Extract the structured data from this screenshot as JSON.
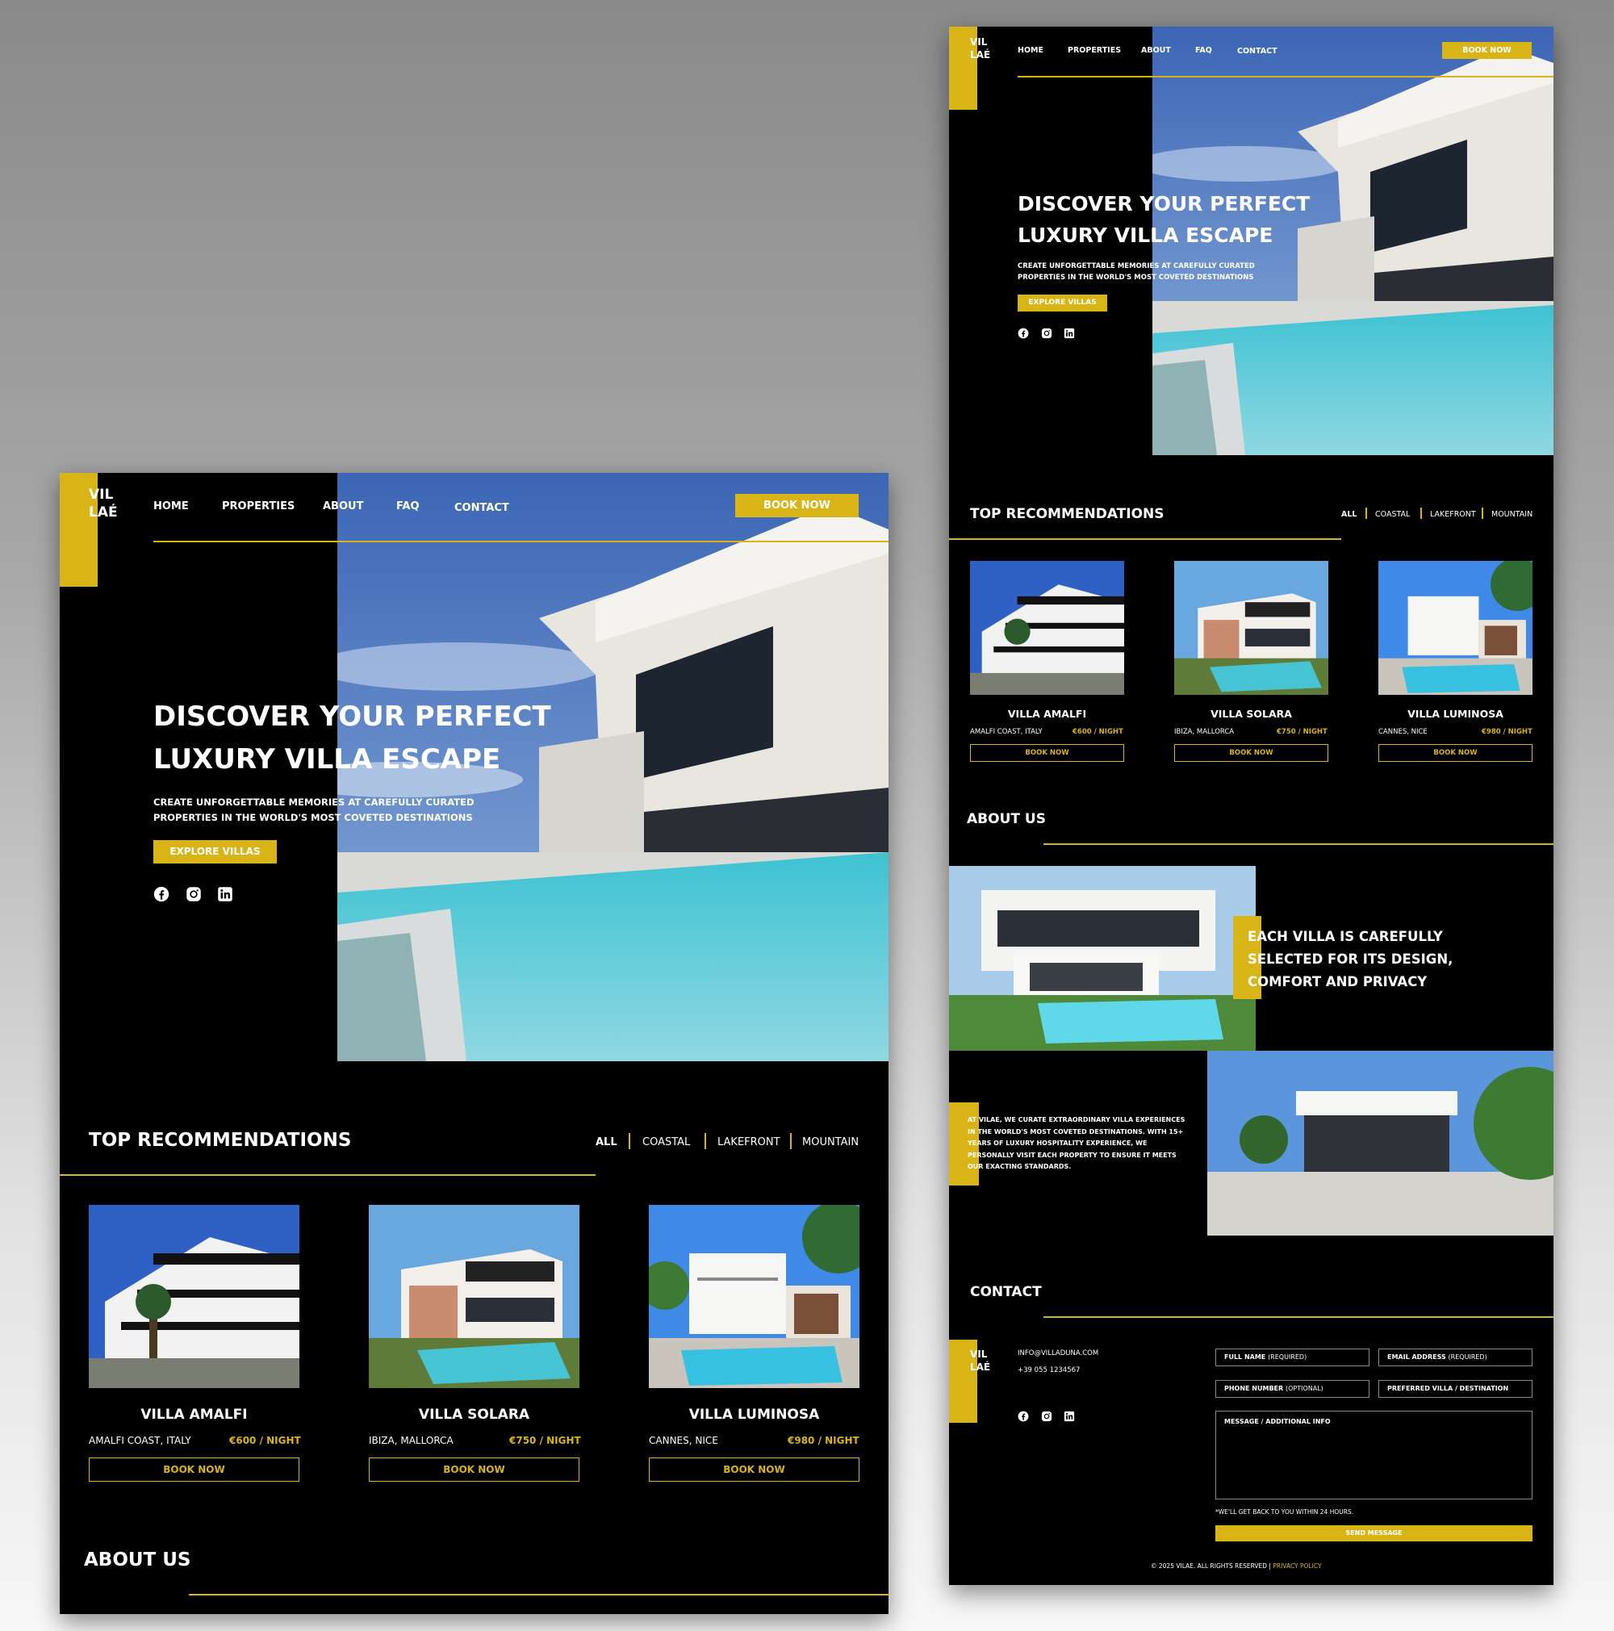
{
  "brand": {
    "line1": "VIL",
    "line2": "LAÉ"
  },
  "nav": {
    "home": "HOME",
    "properties": "PROPERTIES",
    "about": "ABOUT",
    "faq": "FAQ",
    "contact": "CONTACT",
    "book": "BOOK NOW"
  },
  "hero": {
    "title_line1": "DISCOVER YOUR PERFECT",
    "title_line2": "LUXURY VILLA ESCAPE",
    "sub_line1": "CREATE UNFORGETTABLE MEMORIES AT CAREFULLY CURATED",
    "sub_line2": "PROPERTIES IN THE WORLD'S MOST COVETED DESTINATIONS",
    "cta": "EXPLORE VILLAS"
  },
  "social": [
    "facebook-icon",
    "instagram-icon",
    "linkedin-icon"
  ],
  "recommendations": {
    "title": "TOP RECOMMENDATIONS",
    "filters": [
      "ALL",
      "COASTAL",
      "LAKEFRONT",
      "MOUNTAIN"
    ],
    "villas": [
      {
        "name": "VILLA AMALFI",
        "location": "AMALFI COAST, ITALY",
        "price": "€600 / NIGHT",
        "cta": "BOOK NOW"
      },
      {
        "name": "VILLA SOLARA",
        "location": "IBIZA, MALLORCA",
        "price": "€750 / NIGHT",
        "cta": "BOOK NOW"
      },
      {
        "name": "VILLA LUMINOSA",
        "location": "CANNES, NICE",
        "price": "€980 / NIGHT",
        "cta": "BOOK NOW"
      }
    ]
  },
  "about": {
    "title": "ABOUT US",
    "headline_line1": "EACH VILLA IS CAREFULLY",
    "headline_line2": "SELECTED FOR ITS DESIGN,",
    "headline_line3": "COMFORT AND PRIVACY",
    "body_line1": "AT VILAE, WE CURATE EXTRAORDINARY  VILLA EXPERIENCES",
    "body_line2": "IN THE WORLD'S  MOST COVETED DESTINATIONS. WITH 15+",
    "body_line3": "YEARS OF LUXURY HOSPITALITY  EXPERIENCE, WE",
    "body_line4": "PERSONALLY VISIT EACH  PROPERTY TO ENSURE IT MEETS",
    "body_line5": "OUR  EXACTING STANDARDS."
  },
  "contact": {
    "title": "CONTACT",
    "email": "INFO@VILLADUNA.COM",
    "phone": "+39 055 1234567",
    "fields": {
      "full_name": "FULL NAME",
      "full_name_note": "(REQUIRED)",
      "email_address": "EMAIL ADDRESS",
      "email_note": "(REQUIRED)",
      "phone_number": "PHONE NUMBER",
      "phone_note": "(OPTIONAL)",
      "villa": "PREFERRED VILLA / DESTINATION",
      "message": "MESSAGE / ADDITIONAL INFO"
    },
    "note": "*WE'LL GET BACK TO YOU WITHIN 24 HOURS.",
    "send": "SEND MESSAGE"
  },
  "footer": {
    "copyright": "© 2025 VILAE. ALL RIGHTS RESERVED |",
    "privacy": "PRIVACY POLICY"
  },
  "colors": {
    "accent": "#d8b417",
    "background": "#000000",
    "text": "#ffffff"
  }
}
